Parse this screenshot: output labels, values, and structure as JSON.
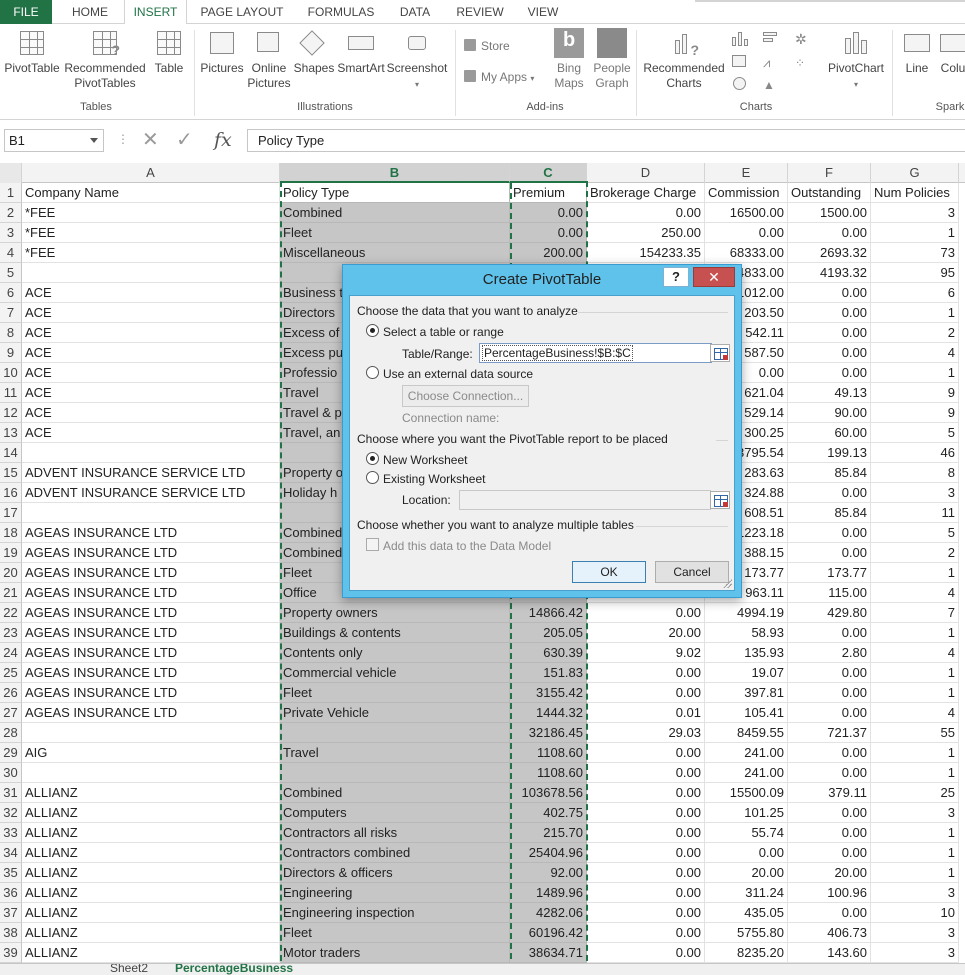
{
  "ribbon_tabs": [
    "FILE",
    "HOME",
    "INSERT",
    "PAGE LAYOUT",
    "FORMULAS",
    "DATA",
    "REVIEW",
    "VIEW"
  ],
  "active_tab": "INSERT",
  "ribbon": {
    "tables": {
      "label": "Tables",
      "pivottable": "PivotTable",
      "recommended_pivot_1": "Recommended",
      "recommended_pivot_2": "PivotTables",
      "table": "Table"
    },
    "illustrations": {
      "label": "Illustrations",
      "pictures": "Pictures",
      "online_pictures_1": "Online",
      "online_pictures_2": "Pictures",
      "shapes": "Shapes",
      "smartart": "SmartArt",
      "screenshot": "Screenshot"
    },
    "addins": {
      "label": "Add-ins",
      "store": "Store",
      "my_apps": "My Apps",
      "bing_1": "Bing",
      "bing_2": "Maps",
      "people_1": "People",
      "people_2": "Graph"
    },
    "charts": {
      "label": "Charts",
      "recommended_1": "Recommended",
      "recommended_2": "Charts",
      "pivotchart": "PivotChart"
    },
    "sparklines": {
      "label": "Spark",
      "line": "Line",
      "column": "Colu"
    }
  },
  "formula_bar": {
    "name_box": "B1",
    "fx": "fx",
    "formula": "Policy Type"
  },
  "columns": [
    "A",
    "B",
    "C",
    "D",
    "E",
    "F",
    "G"
  ],
  "rows": [
    {
      "n": "1",
      "a": "Company Name",
      "b": "Policy Type",
      "c": "Premium",
      "d": "Brokerage Charge",
      "e": "Commission",
      "f": "Outstanding",
      "g": "Num Policies"
    },
    {
      "n": "2",
      "a": "*FEE",
      "b": "Combined",
      "c": "0.00",
      "d": "0.00",
      "e": "16500.00",
      "f": "1500.00",
      "g": "3"
    },
    {
      "n": "3",
      "a": "*FEE",
      "b": "Fleet",
      "c": "0.00",
      "d": "250.00",
      "e": "0.00",
      "f": "0.00",
      "g": "1"
    },
    {
      "n": "4",
      "a": "*FEE",
      "b": "Miscellaneous",
      "c": "200.00",
      "d": "154233.35",
      "e": "68333.00",
      "f": "2693.32",
      "g": "73"
    },
    {
      "n": "5",
      "a": "",
      "b": "",
      "c": "",
      "d": "",
      "e": "4833.00",
      "f": "4193.32",
      "g": "95"
    },
    {
      "n": "6",
      "a": "ACE",
      "b": "Business t",
      "c": "",
      "d": "",
      "e": "1012.00",
      "f": "0.00",
      "g": "6"
    },
    {
      "n": "7",
      "a": "ACE",
      "b": "Directors",
      "c": "",
      "d": "",
      "e": "203.50",
      "f": "0.00",
      "g": "1"
    },
    {
      "n": "8",
      "a": "ACE",
      "b": "Excess of",
      "c": "",
      "d": "",
      "e": "542.11",
      "f": "0.00",
      "g": "2"
    },
    {
      "n": "9",
      "a": "ACE",
      "b": "Excess pu",
      "c": "",
      "d": "",
      "e": "587.50",
      "f": "0.00",
      "g": "4"
    },
    {
      "n": "10",
      "a": "ACE",
      "b": "Professio",
      "c": "",
      "d": "",
      "e": "0.00",
      "f": "0.00",
      "g": "1"
    },
    {
      "n": "11",
      "a": "ACE",
      "b": "Travel",
      "c": "",
      "d": "",
      "e": "621.04",
      "f": "49.13",
      "g": "9"
    },
    {
      "n": "12",
      "a": "ACE",
      "b": "Travel & p",
      "c": "",
      "d": "",
      "e": "529.14",
      "f": "90.00",
      "g": "9"
    },
    {
      "n": "13",
      "a": "ACE",
      "b": "Travel, an",
      "c": "",
      "d": "",
      "e": "300.25",
      "f": "60.00",
      "g": "5"
    },
    {
      "n": "14",
      "a": "",
      "b": "",
      "c": "",
      "d": "",
      "e": "3795.54",
      "f": "199.13",
      "g": "46"
    },
    {
      "n": "15",
      "a": "ADVENT INSURANCE SERVICE LTD",
      "b": "Property o",
      "c": "",
      "d": "",
      "e": "283.63",
      "f": "85.84",
      "g": "8"
    },
    {
      "n": "16",
      "a": "ADVENT INSURANCE SERVICE LTD",
      "b": "Holiday h",
      "c": "",
      "d": "",
      "e": "324.88",
      "f": "0.00",
      "g": "3"
    },
    {
      "n": "17",
      "a": "",
      "b": "",
      "c": "",
      "d": "",
      "e": "608.51",
      "f": "85.84",
      "g": "11"
    },
    {
      "n": "18",
      "a": "AGEAS INSURANCE LTD",
      "b": "Combined",
      "c": "",
      "d": "",
      "e": "1223.18",
      "f": "0.00",
      "g": "5"
    },
    {
      "n": "19",
      "a": "AGEAS INSURANCE LTD",
      "b": "Combined",
      "c": "",
      "d": "",
      "e": "388.15",
      "f": "0.00",
      "g": "2"
    },
    {
      "n": "20",
      "a": "AGEAS INSURANCE LTD",
      "b": "Fleet",
      "c": "",
      "d": "",
      "e": "173.77",
      "f": "173.77",
      "g": "1"
    },
    {
      "n": "21",
      "a": "AGEAS INSURANCE LTD",
      "b": "Office",
      "c": "",
      "d": "",
      "e": "963.11",
      "f": "115.00",
      "g": "4"
    },
    {
      "n": "22",
      "a": "AGEAS INSURANCE LTD",
      "b": "Property owners",
      "c": "14866.42",
      "d": "0.00",
      "e": "4994.19",
      "f": "429.80",
      "g": "7"
    },
    {
      "n": "23",
      "a": "AGEAS INSURANCE LTD",
      "b": "Buildings & contents",
      "c": "205.05",
      "d": "20.00",
      "e": "58.93",
      "f": "0.00",
      "g": "1"
    },
    {
      "n": "24",
      "a": "AGEAS INSURANCE LTD",
      "b": "Contents only",
      "c": "630.39",
      "d": "9.02",
      "e": "135.93",
      "f": "2.80",
      "g": "4"
    },
    {
      "n": "25",
      "a": "AGEAS INSURANCE LTD",
      "b": "Commercial vehicle",
      "c": "151.83",
      "d": "0.00",
      "e": "19.07",
      "f": "0.00",
      "g": "1"
    },
    {
      "n": "26",
      "a": "AGEAS INSURANCE LTD",
      "b": "Fleet",
      "c": "3155.42",
      "d": "0.00",
      "e": "397.81",
      "f": "0.00",
      "g": "1"
    },
    {
      "n": "27",
      "a": "AGEAS INSURANCE LTD",
      "b": "Private Vehicle",
      "c": "1444.32",
      "d": "0.01",
      "e": "105.41",
      "f": "0.00",
      "g": "4"
    },
    {
      "n": "28",
      "a": "",
      "b": "",
      "c": "32186.45",
      "d": "29.03",
      "e": "8459.55",
      "f": "721.37",
      "g": "55"
    },
    {
      "n": "29",
      "a": "AIG",
      "b": "Travel",
      "c": "1108.60",
      "d": "0.00",
      "e": "241.00",
      "f": "0.00",
      "g": "1"
    },
    {
      "n": "30",
      "a": "",
      "b": "",
      "c": "1108.60",
      "d": "0.00",
      "e": "241.00",
      "f": "0.00",
      "g": "1"
    },
    {
      "n": "31",
      "a": "ALLIANZ",
      "b": "Combined",
      "c": "103678.56",
      "d": "0.00",
      "e": "15500.09",
      "f": "379.11",
      "g": "25"
    },
    {
      "n": "32",
      "a": "ALLIANZ",
      "b": "Computers",
      "c": "402.75",
      "d": "0.00",
      "e": "101.25",
      "f": "0.00",
      "g": "3"
    },
    {
      "n": "33",
      "a": "ALLIANZ",
      "b": "Contractors all risks",
      "c": "215.70",
      "d": "0.00",
      "e": "55.74",
      "f": "0.00",
      "g": "1"
    },
    {
      "n": "34",
      "a": "ALLIANZ",
      "b": "Contractors combined",
      "c": "25404.96",
      "d": "0.00",
      "e": "0.00",
      "f": "0.00",
      "g": "1"
    },
    {
      "n": "35",
      "a": "ALLIANZ",
      "b": "Directors & officers",
      "c": "92.00",
      "d": "0.00",
      "e": "20.00",
      "f": "20.00",
      "g": "1"
    },
    {
      "n": "36",
      "a": "ALLIANZ",
      "b": "Engineering",
      "c": "1489.96",
      "d": "0.00",
      "e": "311.24",
      "f": "100.96",
      "g": "3"
    },
    {
      "n": "37",
      "a": "ALLIANZ",
      "b": "Engineering inspection",
      "c": "4282.06",
      "d": "0.00",
      "e": "435.05",
      "f": "0.00",
      "g": "10"
    },
    {
      "n": "38",
      "a": "ALLIANZ",
      "b": "Fleet",
      "c": "60196.42",
      "d": "0.00",
      "e": "5755.80",
      "f": "406.73",
      "g": "3"
    },
    {
      "n": "39",
      "a": "ALLIANZ",
      "b": "Motor traders",
      "c": "38634.71",
      "d": "0.00",
      "e": "8235.20",
      "f": "143.60",
      "g": "3"
    }
  ],
  "sheet_tabs": [
    "Sheet2",
    "PercentageBusiness"
  ],
  "dialog": {
    "title": "Create PivotTable",
    "help": "?",
    "close": "✕",
    "section1": "Choose the data that you want to analyze",
    "opt_table": "Select a table or range",
    "table_range_label": "Table/Range:",
    "table_range_value": "PercentageBusiness!$B:$C",
    "opt_external": "Use an external data source",
    "choose_connection": "Choose Connection...",
    "connection_name": "Connection name:",
    "section2": "Choose where you want the PivotTable report to be placed",
    "opt_new": "New Worksheet",
    "opt_existing": "Existing Worksheet",
    "location_label": "Location:",
    "location_value": "",
    "section3": "Choose whether you want to analyze multiple tables",
    "data_model": "Add this data to the Data Model",
    "ok": "OK",
    "cancel": "Cancel"
  }
}
